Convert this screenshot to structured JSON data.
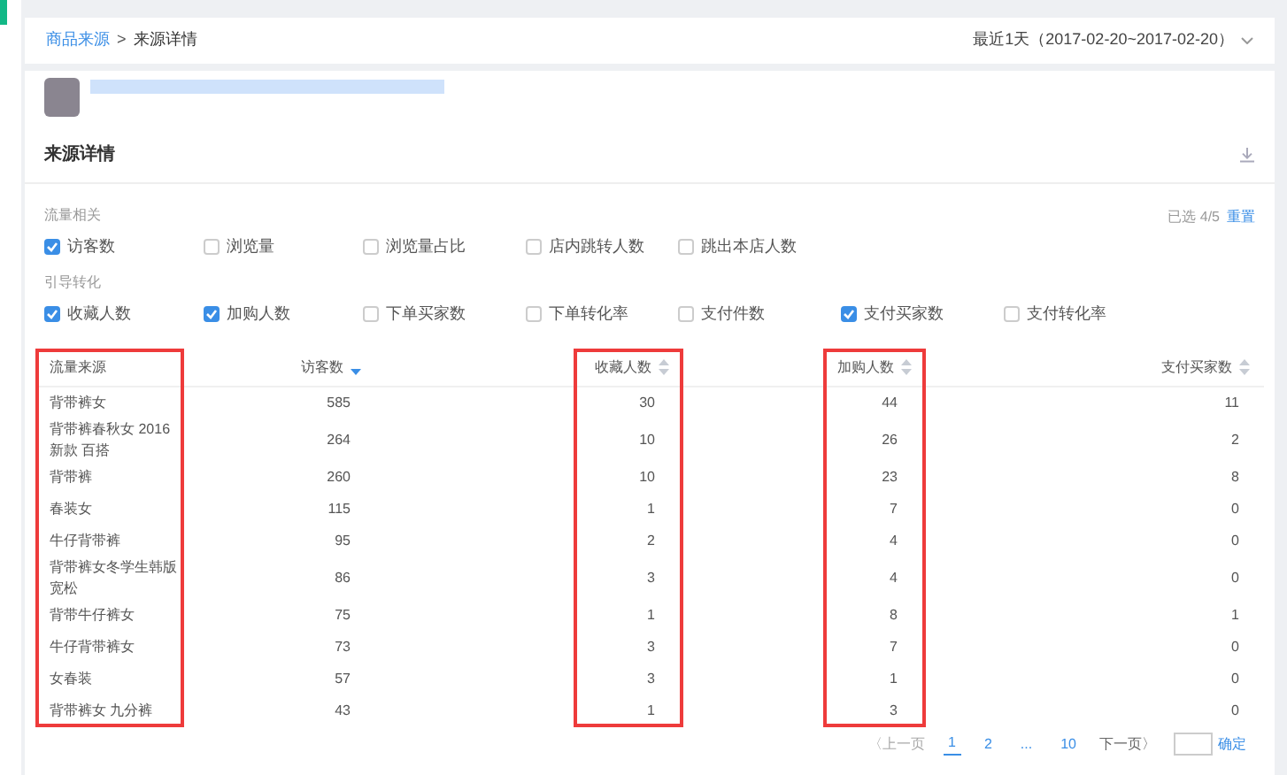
{
  "breadcrumb": {
    "link": "商品来源",
    "separator": ">",
    "current": "来源详情"
  },
  "date_range": "最近1天（2017-02-20~2017-02-20）",
  "section_title": "来源详情",
  "metric_groups": [
    {
      "label": "流量相关",
      "options": [
        {
          "label": "访客数",
          "checked": true
        },
        {
          "label": "浏览量",
          "checked": false
        },
        {
          "label": "浏览量占比",
          "checked": false
        },
        {
          "label": "店内跳转人数",
          "checked": false
        },
        {
          "label": "跳出本店人数",
          "checked": false
        }
      ]
    },
    {
      "label": "引导转化",
      "options": [
        {
          "label": "收藏人数",
          "checked": true
        },
        {
          "label": "加购人数",
          "checked": true
        },
        {
          "label": "下单买家数",
          "checked": false
        },
        {
          "label": "下单转化率",
          "checked": false
        },
        {
          "label": "支付件数",
          "checked": false
        },
        {
          "label": "支付买家数",
          "checked": true
        },
        {
          "label": "支付转化率",
          "checked": false
        }
      ]
    }
  ],
  "selection_count": "已选 4/5",
  "reset": "重置",
  "table": {
    "columns": [
      {
        "label": "流量来源",
        "sortable": false,
        "highlighted": true
      },
      {
        "label": "访客数",
        "sortable": true,
        "sorted": true,
        "highlighted": false
      },
      {
        "label": "收藏人数",
        "sortable": true,
        "sorted": false,
        "highlighted": true
      },
      {
        "label": "加购人数",
        "sortable": true,
        "sorted": false,
        "highlighted": true
      },
      {
        "label": "支付买家数",
        "sortable": true,
        "sorted": false,
        "highlighted": false
      }
    ],
    "rows": [
      [
        "背带裤女",
        "585",
        "30",
        "44",
        "11"
      ],
      [
        "背带裤春秋女 2016新款 百搭",
        "264",
        "10",
        "26",
        "2"
      ],
      [
        "背带裤",
        "260",
        "10",
        "23",
        "8"
      ],
      [
        "春装女",
        "115",
        "1",
        "7",
        "0"
      ],
      [
        "牛仔背带裤",
        "95",
        "2",
        "4",
        "0"
      ],
      [
        "背带裤女冬学生韩版宽松",
        "86",
        "3",
        "4",
        "0"
      ],
      [
        "背带牛仔裤女",
        "75",
        "1",
        "8",
        "1"
      ],
      [
        "牛仔背带裤女",
        "73",
        "3",
        "7",
        "0"
      ],
      [
        "女春装",
        "57",
        "3",
        "1",
        "0"
      ],
      [
        "背带裤女 九分裤",
        "43",
        "1",
        "3",
        "0"
      ]
    ]
  },
  "pagination": {
    "prev": "〈上一页",
    "pages": [
      {
        "label": "1",
        "selected": true
      },
      {
        "label": "2",
        "selected": false
      },
      {
        "label": "...",
        "selected": false
      },
      {
        "label": "10",
        "selected": false
      }
    ],
    "next": "下一页〉",
    "confirm": "确定"
  }
}
